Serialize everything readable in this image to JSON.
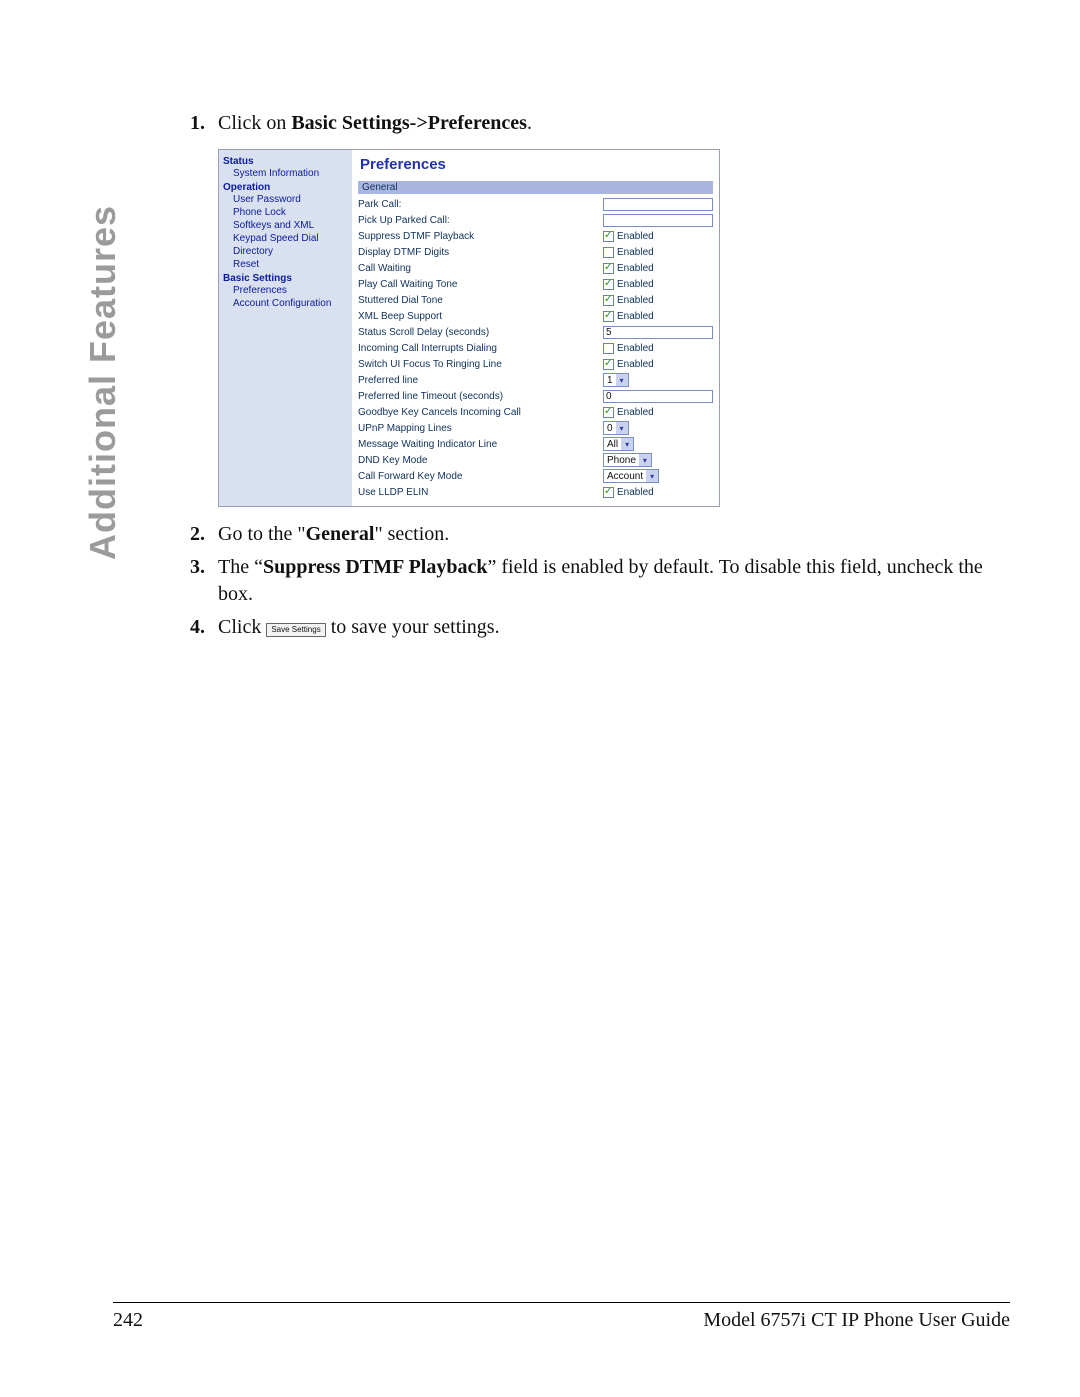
{
  "side_title": "Additional Features",
  "steps": {
    "s1_num": "1.",
    "s1_a": "Click on ",
    "s1_b": "Basic Settings->Preferences",
    "s1_c": ".",
    "s2_num": "2.",
    "s2_a": "Go to the \"",
    "s2_b": "General",
    "s2_c": "\" section.",
    "s3_num": "3.",
    "s3_a": "The “",
    "s3_b": "Suppress DTMF Playback",
    "s3_c": "” field is enabled by default. To disable this field, uncheck the box.",
    "s4_num": "4.",
    "s4_a": "Click ",
    "s4_btn": "Save Settings",
    "s4_b": " to save your settings."
  },
  "sidebar": {
    "status": "Status",
    "sysinfo": "System Information",
    "operation": "Operation",
    "user_password": "User Password",
    "phone_lock": "Phone Lock",
    "softkeys_xml": "Softkeys and XML",
    "keypad_speed": "Keypad Speed Dial",
    "directory": "Directory",
    "reset": "Reset",
    "basic_settings": "Basic Settings",
    "preferences": "Preferences",
    "account_config": "Account Configuration"
  },
  "prefs": {
    "title": "Preferences",
    "section": "General",
    "enabled_lbl": "Enabled",
    "rows": {
      "park_call": "Park Call:",
      "pick_up": "Pick Up Parked Call:",
      "suppress_dtmf": "Suppress DTMF Playback",
      "display_dtmf": "Display DTMF Digits",
      "call_waiting": "Call Waiting",
      "play_cw_tone": "Play Call Waiting Tone",
      "stuttered": "Stuttered Dial Tone",
      "xml_beep": "XML Beep Support",
      "scroll_delay": "Status Scroll Delay (seconds)",
      "incoming_interrupts": "Incoming Call Interrupts Dialing",
      "switch_ui": "Switch UI Focus To Ringing Line",
      "pref_line": "Preferred line",
      "pref_line_timeout": "Preferred line Timeout (seconds)",
      "goodbye": "Goodbye Key Cancels Incoming Call",
      "upnp": "UPnP Mapping Lines",
      "mwi_line": "Message Waiting Indicator Line",
      "dnd_mode": "DND Key Mode",
      "cfwd_mode": "Call Forward Key Mode",
      "lldp": "Use LLDP ELIN"
    },
    "vals": {
      "scroll_delay": "5",
      "pref_line": "1",
      "pref_line_timeout": "0",
      "upnp": "0",
      "mwi_line": "All",
      "dnd_mode": "Phone",
      "cfwd_mode": "Account"
    }
  },
  "footer": {
    "page": "242",
    "title": "Model 6757i CT IP Phone User Guide"
  }
}
